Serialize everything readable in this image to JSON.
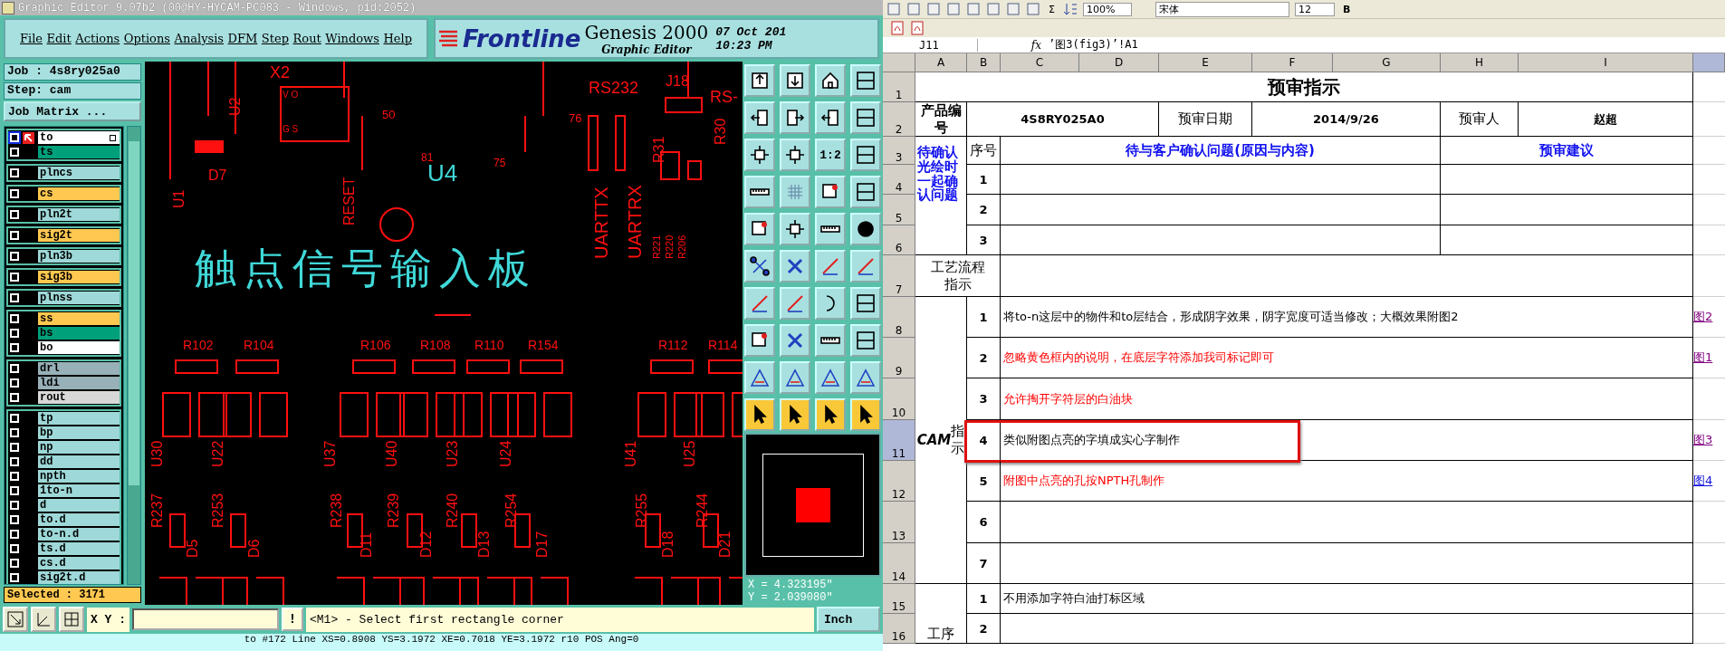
{
  "genesis": {
    "title": "Graphic Editor 9.07b2 (00@HY-HYCAM-PC083 - Windows, pid:2052)",
    "menu": [
      "File",
      "Edit",
      "Actions",
      "Options",
      "Analysis",
      "DFM",
      "Step",
      "Rout",
      "Windows",
      "Help"
    ],
    "brand": {
      "logo": "Frontline",
      "product": "Genesis 2000",
      "subtitle": "Graphic Editor",
      "date": "07 Oct 201",
      "time": "10:23 PM"
    },
    "job": "Job : 4s8ry025a0",
    "step": "Step: cam",
    "job_matrix": "Job Matrix ...",
    "layer_groups": [
      {
        "layers": [
          {
            "name": "to",
            "color": "#ffffff",
            "active": true,
            "checked": false
          },
          {
            "name": "ts",
            "color": "#00a07a",
            "active": false,
            "checked": false
          }
        ]
      },
      {
        "layers": [
          {
            "name": "plncs",
            "color": "#9ed8d8",
            "active": false,
            "checked": false
          }
        ]
      },
      {
        "layers": [
          {
            "name": "cs",
            "color": "#ffc850",
            "active": false,
            "checked": false
          }
        ]
      },
      {
        "layers": [
          {
            "name": "pln2t",
            "color": "#9ed8d8",
            "active": false,
            "checked": false
          }
        ]
      },
      {
        "layers": [
          {
            "name": "sig2t",
            "color": "#ffc850",
            "active": false,
            "checked": false
          }
        ]
      },
      {
        "layers": [
          {
            "name": "pln3b",
            "color": "#9ed8d8",
            "active": false,
            "checked": false
          }
        ]
      },
      {
        "layers": [
          {
            "name": "sig3b",
            "color": "#ffc850",
            "active": false,
            "checked": false
          }
        ]
      },
      {
        "layers": [
          {
            "name": "plnss",
            "color": "#9ed8d8",
            "active": false,
            "checked": false
          }
        ]
      },
      {
        "layers": [
          {
            "name": "ss",
            "color": "#ffc850",
            "active": false,
            "checked": false
          },
          {
            "name": "bs",
            "color": "#00a07a",
            "active": false,
            "checked": false
          },
          {
            "name": "bo",
            "color": "#ffffff",
            "active": false,
            "checked": false
          }
        ]
      },
      {
        "layers": [
          {
            "name": "drl",
            "color": "#98b0b8",
            "active": false,
            "checked": false
          },
          {
            "name": "ldi",
            "color": "#98b0b8",
            "active": false,
            "checked": false
          },
          {
            "name": "rout",
            "color": "#d8d8d8",
            "active": false,
            "checked": false
          }
        ]
      },
      {
        "layers": [
          {
            "name": "tp",
            "color": "#9ed8d8",
            "active": false,
            "checked": false
          },
          {
            "name": "bp",
            "color": "#9ed8d8",
            "active": false,
            "checked": false
          },
          {
            "name": "np",
            "color": "#9ed8d8",
            "active": false,
            "checked": false
          },
          {
            "name": "dd",
            "color": "#9ed8d8",
            "active": false,
            "checked": false
          },
          {
            "name": "npth",
            "color": "#9ed8d8",
            "active": false,
            "checked": false
          },
          {
            "name": "1to-n",
            "color": "#9ed8d8",
            "active": false,
            "checked": false
          },
          {
            "name": "d",
            "color": "#9ed8d8",
            "active": false,
            "checked": false
          },
          {
            "name": "to.d",
            "color": "#9ed8d8",
            "active": false,
            "checked": false
          },
          {
            "name": "to-n.d",
            "color": "#9ed8d8",
            "active": false,
            "checked": false
          },
          {
            "name": "ts.d",
            "color": "#9ed8d8",
            "active": false,
            "checked": false
          },
          {
            "name": "cs.d",
            "color": "#9ed8d8",
            "active": false,
            "checked": false
          },
          {
            "name": "sig2t.d",
            "color": "#9ed8d8",
            "active": false,
            "checked": false
          }
        ]
      }
    ],
    "selected_count": "Selected : 3171",
    "canvas_labels": [
      {
        "text": "X2"
      },
      {
        "text": "U2"
      },
      {
        "text": "V O"
      },
      {
        "text": "G S"
      },
      {
        "text": "50"
      },
      {
        "text": "RS232"
      },
      {
        "text": "J18"
      },
      {
        "text": "RS-"
      },
      {
        "text": "76"
      },
      {
        "text": "R31"
      },
      {
        "text": "R30"
      },
      {
        "text": "81"
      },
      {
        "text": "75"
      },
      {
        "text": "D7"
      },
      {
        "text": "U4"
      },
      {
        "text": "U1"
      },
      {
        "text": "RESET"
      },
      {
        "text": "UARTTX"
      },
      {
        "text": "UARTRX"
      },
      {
        "text": "R221"
      },
      {
        "text": "R220"
      },
      {
        "text": "R206"
      },
      {
        "text": "触点信号输入板"
      },
      {
        "text": "R102"
      },
      {
        "text": "R104"
      },
      {
        "text": "R106"
      },
      {
        "text": "R108"
      },
      {
        "text": "R110"
      },
      {
        "text": "R154"
      },
      {
        "text": "R112"
      },
      {
        "text": "R114"
      },
      {
        "text": "U30"
      },
      {
        "text": "U22"
      },
      {
        "text": "U37"
      },
      {
        "text": "U40"
      },
      {
        "text": "U23"
      },
      {
        "text": "U24"
      },
      {
        "text": "U41"
      },
      {
        "text": "U25"
      },
      {
        "text": "R237"
      },
      {
        "text": "R253"
      },
      {
        "text": "R238"
      },
      {
        "text": "R239"
      },
      {
        "text": "R240"
      },
      {
        "text": "R254"
      },
      {
        "text": "R255"
      },
      {
        "text": "R244"
      },
      {
        "text": "D5"
      },
      {
        "text": "D6"
      },
      {
        "text": "D11"
      },
      {
        "text": "D12"
      },
      {
        "text": "D13"
      },
      {
        "text": "D17"
      },
      {
        "text": "D18"
      },
      {
        "text": "D21"
      }
    ],
    "tools": [
      {
        "kind": "up",
        "selected": false
      },
      {
        "kind": "down",
        "selected": false
      },
      {
        "kind": "home",
        "selected": false
      },
      {
        "kind": "window",
        "selected": false
      },
      {
        "kind": "left",
        "selected": false
      },
      {
        "kind": "right",
        "selected": false
      },
      {
        "kind": "left",
        "selected": false
      },
      {
        "kind": "window",
        "selected": false
      },
      {
        "kind": "fit",
        "selected": false
      },
      {
        "kind": "fit",
        "selected": false
      },
      {
        "kind": "ratio",
        "label": "1:2",
        "selected": false
      },
      {
        "kind": "window",
        "selected": false
      },
      {
        "kind": "ruler",
        "selected": false
      },
      {
        "kind": "grid",
        "selected": false
      },
      {
        "kind": "target",
        "selected": false
      },
      {
        "kind": "window",
        "selected": false
      },
      {
        "kind": "target",
        "selected": false
      },
      {
        "kind": "fit",
        "selected": false
      },
      {
        "kind": "ruler",
        "selected": false
      },
      {
        "kind": "circle",
        "selected": false
      },
      {
        "kind": "nodes",
        "selected": false
      },
      {
        "kind": "cross",
        "selected": false
      },
      {
        "kind": "line",
        "selected": false
      },
      {
        "kind": "line",
        "selected": false
      },
      {
        "kind": "line",
        "selected": false
      },
      {
        "kind": "line",
        "selected": false
      },
      {
        "kind": "arc",
        "selected": false
      },
      {
        "kind": "window",
        "selected": false
      },
      {
        "kind": "target",
        "selected": false
      },
      {
        "kind": "cross",
        "selected": false
      },
      {
        "kind": "ruler",
        "selected": false
      },
      {
        "kind": "window",
        "selected": false
      },
      {
        "kind": "triangle",
        "selected": false
      },
      {
        "kind": "triangle",
        "selected": false
      },
      {
        "kind": "triangle",
        "selected": false
      },
      {
        "kind": "triangle",
        "selected": false
      },
      {
        "kind": "pointer",
        "selected": true
      },
      {
        "kind": "pointer",
        "selected": true
      },
      {
        "kind": "pointer",
        "selected": true
      },
      {
        "kind": "pointer",
        "selected": true
      }
    ],
    "coords": [
      "X = 4.323195\"",
      "Y = 2.039080\""
    ],
    "xy_label": "X Y :",
    "prompt_button": "!",
    "prompt": "<M1> - Select first rectangle corner",
    "units": "Inch",
    "status": "to #172 Line XS=0.8908 YS=3.1972 XE=0.7018 YE=3.1972 r10 POS Ang=0"
  },
  "excel": {
    "toolbar": {
      "sum": "Σ",
      "zoom": "100%",
      "font": "宋体",
      "size": "12",
      "bold": "B"
    },
    "name_box": "J11",
    "fx": "fx",
    "formula": "’图3(fig3)’!A1",
    "columns": [
      {
        "label": "A",
        "selected": false
      },
      {
        "label": "B",
        "selected": false
      },
      {
        "label": "C",
        "selected": false
      },
      {
        "label": "D",
        "selected": false
      },
      {
        "label": "E",
        "selected": false
      },
      {
        "label": "F",
        "selected": false
      },
      {
        "label": "G",
        "selected": false
      },
      {
        "label": "H",
        "selected": false
      },
      {
        "label": "I",
        "selected": false
      }
    ],
    "next_column_selected": true,
    "rows": [
      {
        "label": "1",
        "selected": false
      },
      {
        "label": "2",
        "selected": false
      },
      {
        "label": "3",
        "selected": false
      },
      {
        "label": "4",
        "selected": false
      },
      {
        "label": "5",
        "selected": false
      },
      {
        "label": "6",
        "selected": false
      },
      {
        "label": "7",
        "selected": false
      },
      {
        "label": "8",
        "selected": false
      },
      {
        "label": "9",
        "selected": false
      },
      {
        "label": "10",
        "selected": false
      },
      {
        "label": "11",
        "selected": true
      },
      {
        "label": "12",
        "selected": false
      },
      {
        "label": "13",
        "selected": false
      },
      {
        "label": "14",
        "selected": false
      },
      {
        "label": "15",
        "selected": false
      },
      {
        "label": "16",
        "selected": false
      }
    ],
    "title": "预审指示",
    "product_label": "产品编号",
    "product": "4S8RY025A0",
    "date_label": "预审日期",
    "date": "2014/9/26",
    "reviewer_label": "预审人",
    "reviewer": "赵超",
    "confirm_label": "待确认光绘时一起确认问题",
    "seq_label": "序号",
    "question_header": "待与客户确认问题(原因与内容)",
    "advice_header": "预审建议",
    "confirm_rows": [
      "1",
      "2",
      "3"
    ],
    "process_label": "工艺流程指示",
    "cam_label": "**CAM**指示",
    "cam_items": [
      {
        "no": "1",
        "text": "将to-n这层中的物件和to层结合，形成阴字效果，阴字宽度可适当修改；大概效果附图2",
        "color": "#000000",
        "highlighted": false,
        "link": "图2"
      },
      {
        "no": "2",
        "text": "忽略黄色框内的说明，在底层字符添加我司标记即可",
        "color": "#ff0000",
        "highlighted": false,
        "link": "图1"
      },
      {
        "no": "3",
        "text": "允许掏开字符层的白油块",
        "color": "#ff0000",
        "highlighted": false
      },
      {
        "no": "4",
        "text": "类似附图点亮的字填成实心字制作",
        "color": "#000000",
        "highlighted": true,
        "link": "图3"
      },
      {
        "no": "5",
        "text": "附图中点亮的孔按NPTH孔制作",
        "color": "#ff0000",
        "highlighted": false,
        "link": "图4"
      },
      {
        "no": "6",
        "highlighted": false
      },
      {
        "no": "7",
        "highlighted": false
      }
    ],
    "process2_label": "工序",
    "process2_items": [
      {
        "no": "1",
        "text": "不用添加字符白油打标区域"
      },
      {
        "no": "2"
      }
    ]
  }
}
